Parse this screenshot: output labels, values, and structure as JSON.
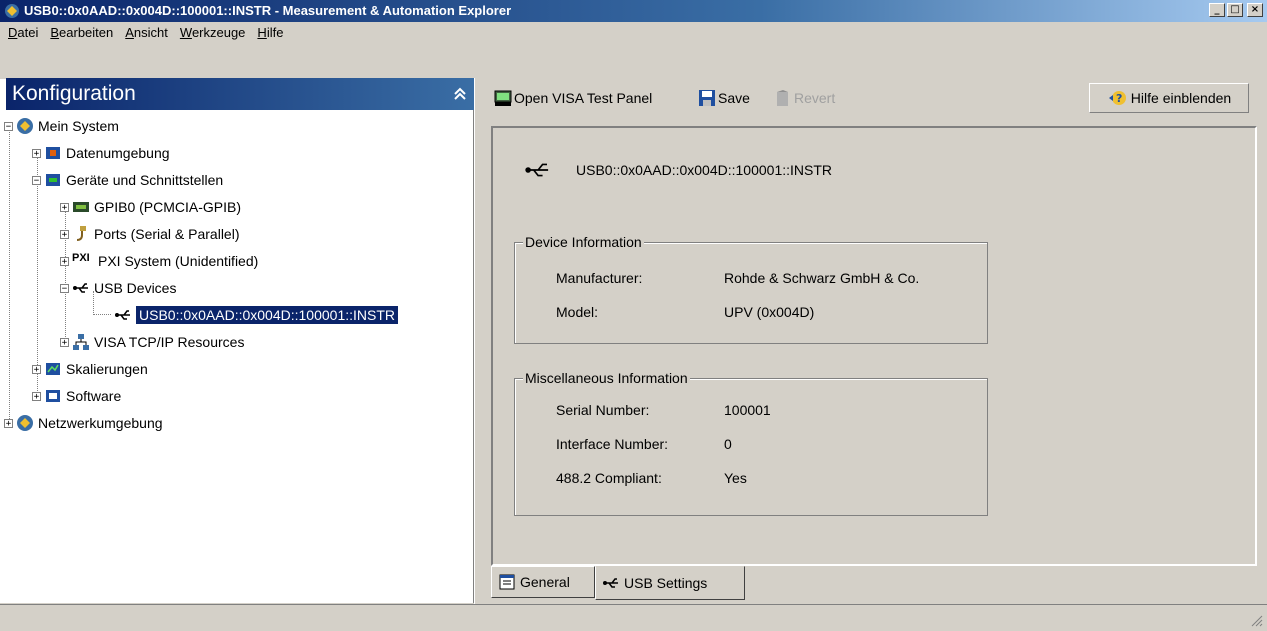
{
  "window": {
    "title": "USB0::0x0AAD::0x004D::100001::INSTR - Measurement & Automation Explorer",
    "controls": {
      "minimize": "_",
      "maximize": "□",
      "close": "×"
    }
  },
  "menu": {
    "items": [
      {
        "label": "Datei",
        "accel": "D",
        "rest": "atei"
      },
      {
        "label": "Bearbeiten",
        "accel": "B",
        "rest": "earbeiten"
      },
      {
        "label": "Ansicht",
        "accel": "A",
        "rest": "nsicht"
      },
      {
        "label": "Werkzeuge",
        "accel": "W",
        "rest": "erkzeuge"
      },
      {
        "label": "Hilfe",
        "accel": "H",
        "rest": "ilfe"
      }
    ]
  },
  "sidebar": {
    "header": "Konfiguration",
    "tree": [
      {
        "label": "Mein System",
        "icon": "system-icon",
        "expander": "−"
      },
      {
        "label": "Datenumgebung",
        "icon": "data-icon",
        "expander": "+"
      },
      {
        "label": "Geräte und Schnittstellen",
        "icon": "devices-icon",
        "expander": "−"
      },
      {
        "label": "GPIB0 (PCMCIA-GPIB)",
        "icon": "gpib-icon",
        "expander": "+"
      },
      {
        "label": "Ports (Serial & Parallel)",
        "icon": "port-icon",
        "expander": "+"
      },
      {
        "label": "PXI System (Unidentified)",
        "icon": "pxi-icon",
        "expander": "+",
        "badge": "PXI"
      },
      {
        "label": "USB Devices",
        "icon": "usb-icon",
        "expander": "−"
      },
      {
        "label": "USB0::0x0AAD::0x004D::100001::INSTR",
        "icon": "usb-icon",
        "selected": true
      },
      {
        "label": "VISA TCP/IP Resources",
        "icon": "network-icon",
        "expander": "+"
      },
      {
        "label": "Skalierungen",
        "icon": "scales-icon",
        "expander": "+"
      },
      {
        "label": "Software",
        "icon": "software-icon",
        "expander": "+"
      },
      {
        "label": "Netzwerkumgebung",
        "icon": "system-icon",
        "expander": "+"
      }
    ]
  },
  "toolbar": {
    "open_visa": "Open VISA Test Panel",
    "save": "Save",
    "revert": "Revert",
    "help": "Hilfe einblenden"
  },
  "device": {
    "resource_name": "USB0::0x0AAD::0x004D::100001::INSTR",
    "device_info": {
      "legend": "Device Information",
      "rows": [
        {
          "label": "Manufacturer:",
          "value": "Rohde & Schwarz GmbH & Co."
        },
        {
          "label": "Model:",
          "value": "UPV (0x004D)"
        }
      ]
    },
    "misc_info": {
      "legend": "Miscellaneous Information",
      "rows": [
        {
          "label": "Serial Number:",
          "value": "100001"
        },
        {
          "label": "Interface Number:",
          "value": "0"
        },
        {
          "label": "488.2 Compliant:",
          "value": "Yes"
        }
      ]
    }
  },
  "tabs": [
    {
      "label": "General",
      "icon": "properties-icon"
    },
    {
      "label": "USB Settings",
      "icon": "usb-icon",
      "active": true
    }
  ],
  "colors": {
    "title_start": "#0a246a",
    "title_end": "#a6caf0",
    "selection": "#0a246a",
    "face": "#d4d0c8"
  }
}
